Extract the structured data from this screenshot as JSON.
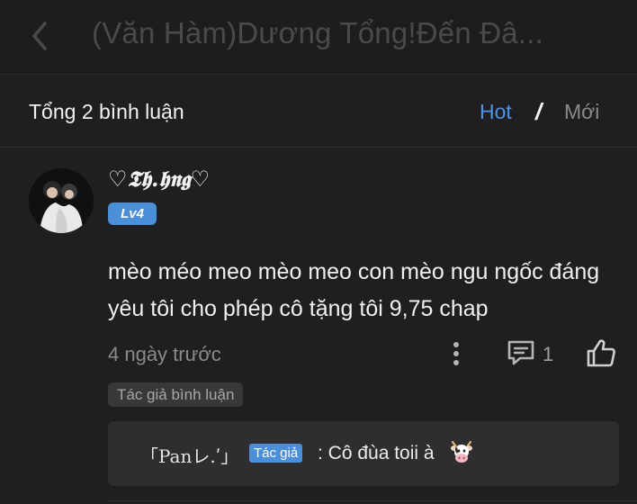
{
  "topbar": {
    "title": "(Văn Hàm)Dương Tổng!Đến Đâ..."
  },
  "comments_header": {
    "total": "Tổng 2 bình luận",
    "sort_hot": "Hot",
    "separator": "/",
    "sort_new": "Mới"
  },
  "comment": {
    "username": "♡𝕿𝖍.𝖍𝖓𝖌♡",
    "level": "Lv4",
    "text": "mèo méo meo mèo meo con mèo ngu ngốc đáng yêu tôi cho phép cô tặng tôi 9,75 chap",
    "timestamp": "4 ngày trước",
    "reply_count": "1",
    "author_tag": "Tác giả bình luận"
  },
  "reply": {
    "author": "「Panレ.ʹ」",
    "author_badge": "Tác giả",
    "text": ": Cô đùa toii à"
  },
  "colors": {
    "accent": "#4d94e8",
    "badge": "#4a8fd8",
    "background": "#1f1f21"
  },
  "icons": [
    "back-icon",
    "more-icon",
    "reply-icon",
    "like-icon",
    "cow-emoji-icon"
  ]
}
